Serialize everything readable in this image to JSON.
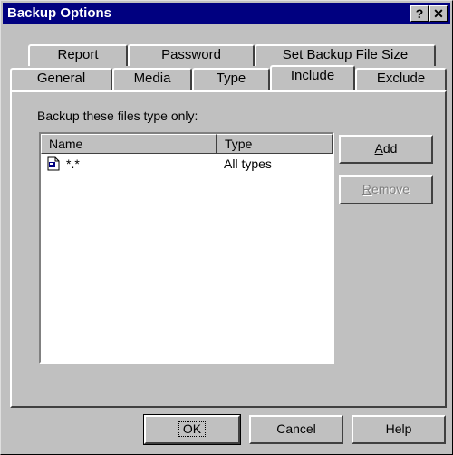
{
  "window": {
    "title": "Backup Options",
    "help_glyph": "?",
    "close_glyph": "✕"
  },
  "tabs": {
    "row_back": [
      "Report",
      "Password",
      "Set Backup File Size"
    ],
    "row_front": [
      "General",
      "Media",
      "Type",
      "Include",
      "Exclude"
    ],
    "active": "Include"
  },
  "include": {
    "label": "Backup these files type only:",
    "columns": [
      "Name",
      "Type"
    ],
    "rows": [
      {
        "name": "*.*",
        "type": "All types",
        "icon": "file-type-icon"
      }
    ]
  },
  "side_buttons": {
    "add": {
      "prefix": "",
      "accel": "A",
      "suffix": "dd"
    },
    "remove": {
      "prefix": "",
      "accel": "R",
      "suffix": "emove",
      "disabled": true
    }
  },
  "footer": {
    "ok": "OK",
    "cancel": "Cancel",
    "help": "Help"
  }
}
